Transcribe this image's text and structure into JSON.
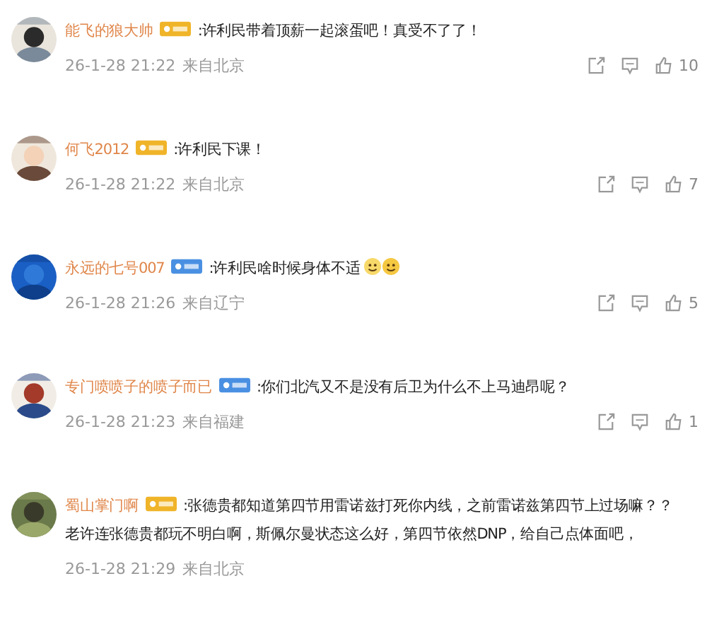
{
  "comments": [
    {
      "avatar": {
        "kind": "picture"
      },
      "name": "能飞的狼大帅",
      "badge": {
        "color": "#f0b429"
      },
      "text_lines": [
        ":许利民带着顶薪一起滚蛋吧！真受不了了！"
      ],
      "time": "26-1-28 21:22",
      "location": "来自北京",
      "likes": "10"
    },
    {
      "avatar": {
        "kind": "picture"
      },
      "name": "何飞2012",
      "badge": {
        "color": "#f0b429"
      },
      "text_lines": [
        ":许利民下课！"
      ],
      "time": "26-1-28 21:22",
      "location": "来自北京",
      "likes": "7"
    },
    {
      "avatar": {
        "kind": "picture"
      },
      "name": "永远的七号007",
      "badge": {
        "color": "#4a90e2"
      },
      "text_lines": [
        ":许利民啥时候身体不适"
      ],
      "emojis": [
        {
          "kind": "emoji"
        },
        {
          "kind": "emoji"
        }
      ],
      "time": "26-1-28 21:26",
      "location": "来自辽宁",
      "likes": "5"
    },
    {
      "avatar": {
        "kind": "picture"
      },
      "name": "专门喷喷子的喷子而已",
      "badge": {
        "color": "#4a90e2"
      },
      "text_lines": [
        ":你们北汽又不是没有后卫为什么不上马迪昂呢？"
      ],
      "time": "26-1-28 21:23",
      "location": "来自福建",
      "likes": "1"
    },
    {
      "avatar": {
        "kind": "picture"
      },
      "name": "蜀山掌门啊",
      "badge": {
        "color": "#f0b429"
      },
      "text_lines": [
        ":张德贵都知道第四节用雷诺兹打死你内线，之前雷诺兹第四节上过场嘛？？",
        "老许连张德贵都玩不明白啊，斯佩尔曼状态这么好，第四节依然DNP，给自己点体面吧，"
      ],
      "time": "26-1-28 21:29",
      "location": "来自北京"
    }
  ]
}
